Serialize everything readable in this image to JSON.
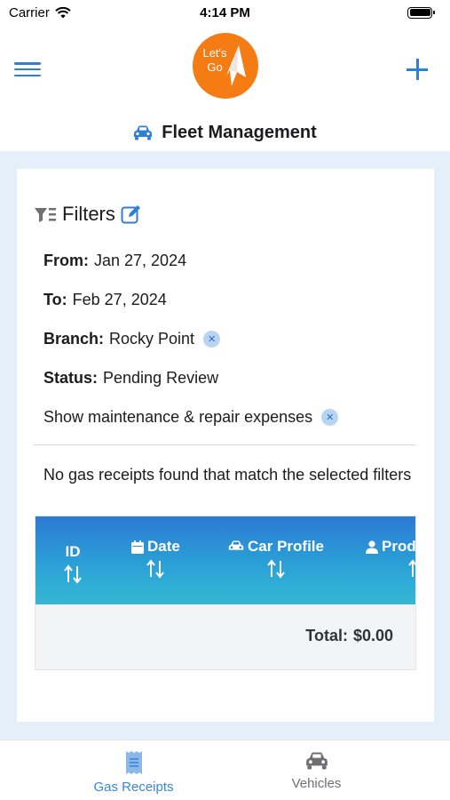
{
  "status_bar": {
    "carrier": "Carrier",
    "time": "4:14 PM"
  },
  "header": {
    "logo_text": "Let's Go"
  },
  "page": {
    "title": "Fleet Management"
  },
  "filters": {
    "title": "Filters",
    "from_label": "From:",
    "from_value": "Jan 27, 2024",
    "to_label": "To:",
    "to_value": "Feb 27, 2024",
    "branch_label": "Branch:",
    "branch_value": "Rocky Point",
    "status_label": "Status:",
    "status_value": "Pending Review",
    "maintenance_label": "Show maintenance & repair expenses"
  },
  "results": {
    "empty_message": "No gas receipts found that match the selected filters"
  },
  "table": {
    "columns": [
      {
        "label": "ID",
        "icon": ""
      },
      {
        "label": "Date",
        "icon": "calendar-icon"
      },
      {
        "label": "Car Profile",
        "icon": "car-icon"
      },
      {
        "label": "Prod",
        "icon": "person-icon"
      }
    ],
    "total_label": "Total:",
    "total_value": "$0.00"
  },
  "tabs": [
    {
      "label": "Gas Receipts",
      "icon": "receipt-icon",
      "active": true
    },
    {
      "label": "Vehicles",
      "icon": "car-icon",
      "active": false
    }
  ],
  "colors": {
    "accent": "#2f7fd6",
    "brand": "#f57c13",
    "background": "#e4effa"
  }
}
